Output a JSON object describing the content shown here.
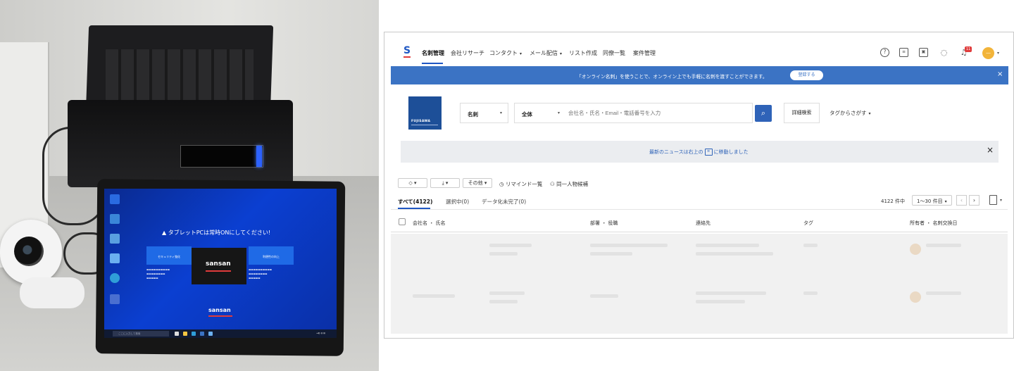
{
  "tablet": {
    "warning": "▲ タブレットPCは常時ONにしてください!",
    "card_security": "セキュリティ強化",
    "card_convenience": "利便性の向上",
    "sansan_logo": "sansan",
    "taskbar_search": "ここに入力して検索"
  },
  "nav": {
    "items": [
      {
        "label": "名刺管理"
      },
      {
        "label": "会社リサーチ"
      },
      {
        "label": "コンタクト"
      },
      {
        "label": "メール配信"
      },
      {
        "label": "リスト作成"
      },
      {
        "label": "同僚一覧"
      },
      {
        "label": "案件管理"
      }
    ],
    "notification_count": "11"
  },
  "banner": {
    "text": "「オンライン名刺」を使うことで、オンライン上でも手軽に名刺を渡すことができます。",
    "button": "登録する",
    "close": "×"
  },
  "org": {
    "name": "FUJISAWA"
  },
  "search": {
    "category": "名刺",
    "scope": "全体",
    "placeholder": "会社名・氏名・Email・電話番号を入力",
    "advanced": "詳細検索",
    "tag_search": "タグからさがす"
  },
  "news": {
    "text_before": "最新のニュースは右上の",
    "text_after": "に移動しました",
    "close": "×"
  },
  "toolbar": {
    "other": "その他",
    "reminder": "リマインド一覧",
    "same_person": "同一人物候補"
  },
  "tabs": [
    {
      "label": "すべて(4122)"
    },
    {
      "label": "選択中(0)"
    },
    {
      "label": "データ化未完了(0)"
    }
  ],
  "pagination": {
    "count": "4122 件中",
    "per_page": "1〜30 件目",
    "prev": "‹",
    "next": "›"
  },
  "table": {
    "columns": [
      {
        "label": "会社名 ・ 氏名"
      },
      {
        "label": "部署 ・ 役職"
      },
      {
        "label": "連絡先"
      },
      {
        "label": "タグ"
      },
      {
        "label": "所有者 ・ 名刺交換日"
      }
    ]
  },
  "colors": {
    "brand_blue": "#1f57c3",
    "banner_blue": "#3b73c4",
    "alert_red": "#e03b3b"
  }
}
